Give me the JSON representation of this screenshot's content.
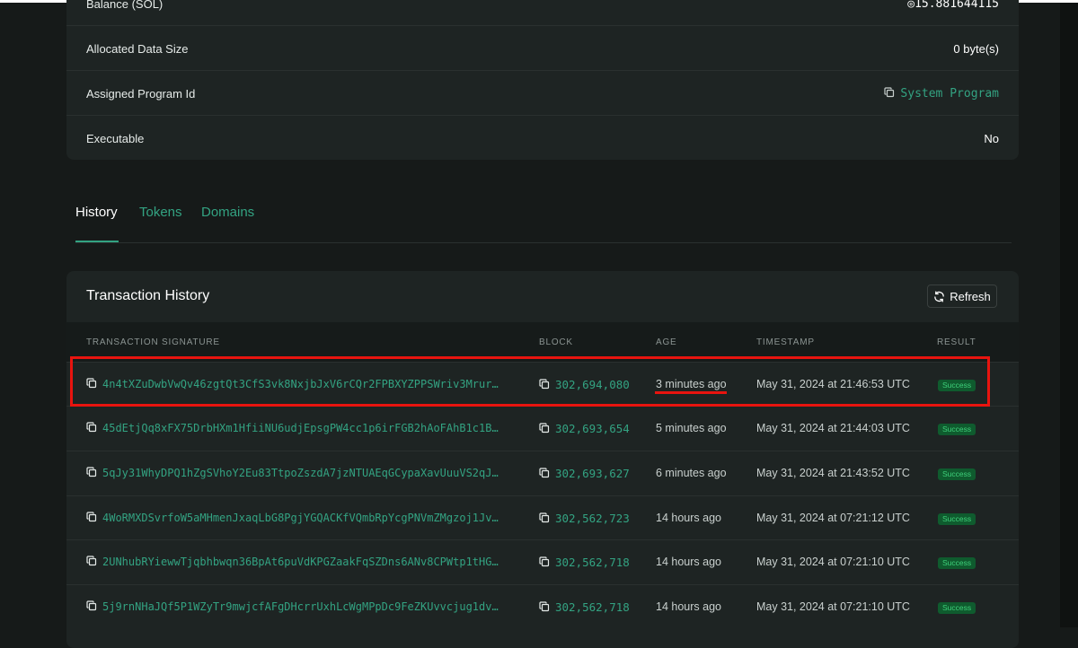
{
  "details": {
    "rows": [
      {
        "label": "Balance (SOL)",
        "value": "◎15.881644115"
      },
      {
        "label": "Allocated Data Size",
        "value": "0 byte(s)"
      },
      {
        "label": "Assigned Program Id",
        "value": "System Program"
      },
      {
        "label": "Executable",
        "value": "No"
      }
    ]
  },
  "tabs": [
    "History",
    "Tokens",
    "Domains"
  ],
  "history": {
    "title": "Transaction History",
    "refresh_label": "Refresh",
    "columns": [
      "TRANSACTION SIGNATURE",
      "BLOCK",
      "AGE",
      "TIMESTAMP",
      "RESULT"
    ],
    "rows": [
      {
        "signature": "4n4tXZuDwbVwQv46zgtQt3CfS3vk8NxjbJxV6rCQr2FPBXYZPPSWriv3Mrur…",
        "block": "302,694,080",
        "age": "3 minutes ago",
        "timestamp": "May 31, 2024 at 21:46:53 UTC",
        "result": "Success"
      },
      {
        "signature": "45dEtjQq8xFX75DrbHXm1HfiiNU6udjEpsgPW4cc1p6irFGB2hAoFAhB1c1B…",
        "block": "302,693,654",
        "age": "5 minutes ago",
        "timestamp": "May 31, 2024 at 21:44:03 UTC",
        "result": "Success"
      },
      {
        "signature": "5qJy31WhyDPQ1hZgSVhoY2Eu83TtpoZszdA7jzNTUAEqGCypaXavUuuVS2qJ…",
        "block": "302,693,627",
        "age": "6 minutes ago",
        "timestamp": "May 31, 2024 at 21:43:52 UTC",
        "result": "Success"
      },
      {
        "signature": "4WoRMXDSvrfoW5aMHmenJxaqLbG8PgjYGQACKfVQmbRpYcgPNVmZMgzoj1Jv…",
        "block": "302,562,723",
        "age": "14 hours ago",
        "timestamp": "May 31, 2024 at 07:21:12 UTC",
        "result": "Success"
      },
      {
        "signature": "2UNhubRYiewwTjqbhbwqn36BpAt6puVdKPGZaakFqSZDns6ANv8CPWtp1tHG…",
        "block": "302,562,718",
        "age": "14 hours ago",
        "timestamp": "May 31, 2024 at 07:21:10 UTC",
        "result": "Success"
      },
      {
        "signature": "5j9rnNHaJQf5P1WZyTr9mwjcfAFgDHcrrUxhLcWgMPpDc9FeZKUvvcjug1dv…",
        "block": "302,562,718",
        "age": "14 hours ago",
        "timestamp": "May 31, 2024 at 07:21:10 UTC",
        "result": "Success"
      }
    ]
  },
  "colors": {
    "accent": "#33a382",
    "highlight": "#e8140f",
    "success_bg": "#0f5b2e"
  }
}
